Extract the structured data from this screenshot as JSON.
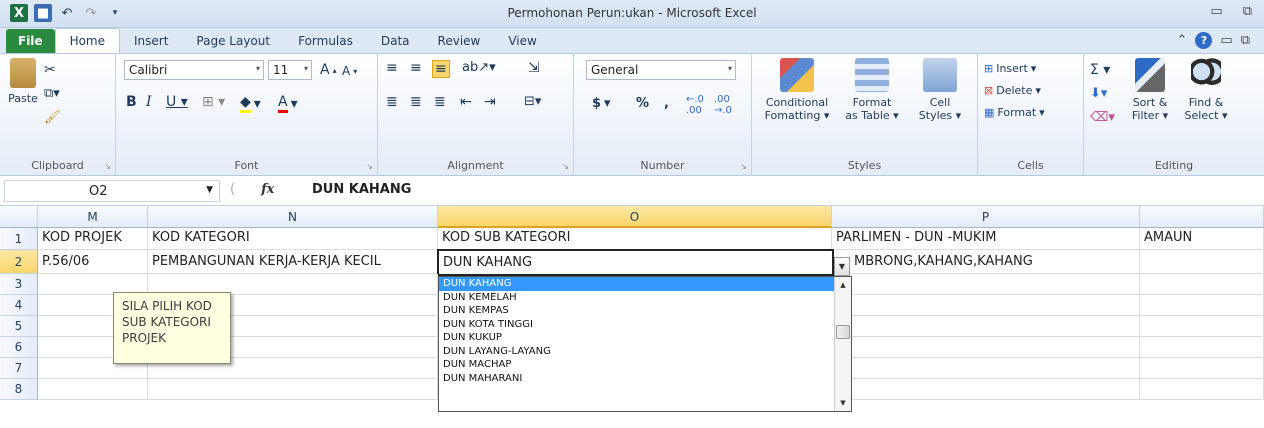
{
  "window": {
    "title": "Permohonan Perun:ukan - Microsoft Excel"
  },
  "ribbon_tabs": [
    "File",
    "Home",
    "Insert",
    "Page Layout",
    "Formulas",
    "Data",
    "Review",
    "View"
  ],
  "clipboard": {
    "paste": "Paste",
    "label": "Clipboard"
  },
  "font": {
    "name": "Calibri",
    "size": "11",
    "label": "Font"
  },
  "alignment": {
    "label": "Alignment"
  },
  "number": {
    "format": "General",
    "currency": "$",
    "percent": "%",
    "comma": ",",
    "label": "Number"
  },
  "styles": {
    "conditional": [
      "Conditional",
      "Fomatting"
    ],
    "format_table": [
      "Format",
      "as Table"
    ],
    "cell_styles": [
      "Cell",
      "Styles"
    ],
    "label": "Styles"
  },
  "cells_group": {
    "insert": "Insert",
    "delete": "Delete",
    "format": "Format",
    "label": "Cells"
  },
  "editing": {
    "sort": [
      "Sort &",
      "Filter"
    ],
    "find": [
      "Find &",
      "Select"
    ],
    "label": "Editing"
  },
  "formula_bar": {
    "name_box": "O2",
    "fx": "fx",
    "content": "DUN KAHANG"
  },
  "columns": [
    "M",
    "N",
    "O",
    "P"
  ],
  "rows": [
    "1",
    "2",
    "3",
    "4",
    "5",
    "6",
    "7",
    "8"
  ],
  "row1": {
    "m": "KOD PROJEK",
    "n": "KOD  KATEGORI",
    "o": "KOD SUB KATEGORI",
    "p": "PARLIMEN - DUN -MUKIM",
    "q": "AMAUN"
  },
  "row2": {
    "m": "P.56/06",
    "n": "PEMBANGUNAN KERJA-KERJA KECIL",
    "o": "DUN KAHANG",
    "p": "MBRONG,KAHANG,KAHANG"
  },
  "comment": {
    "line1": "SILA PILIH KOD",
    "line2": "SUB KATEGORI",
    "line3": "PROJEK"
  },
  "dropdown_items": [
    "DUN KAHANG",
    "DUN KEMELAH",
    "DUN KEMPAS",
    "DUN KOTA TINGGI",
    "DUN KUKUP",
    "DUN LAYANG-LAYANG",
    "DUN MACHAP",
    "DUN MAHARANI"
  ]
}
